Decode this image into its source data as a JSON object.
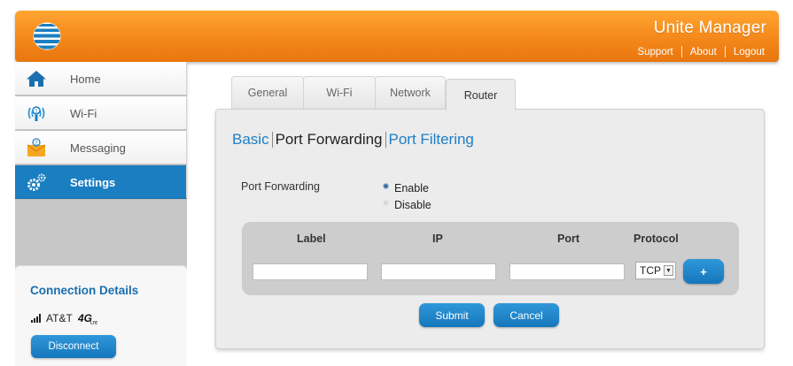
{
  "header": {
    "title": "Unite Manager",
    "links": [
      "Support",
      "About",
      "Logout"
    ],
    "logo_icon": "att-globe-icon"
  },
  "sidebar": {
    "items": [
      {
        "label": "Home",
        "icon": "home-icon",
        "active": false
      },
      {
        "label": "Wi-Fi",
        "icon": "wifi-icon",
        "active": false
      },
      {
        "label": "Messaging",
        "icon": "envelope-icon",
        "active": false
      },
      {
        "label": "Settings",
        "icon": "gear-icon",
        "active": true
      }
    ],
    "connection": {
      "title": "Connection Details",
      "carrier": "AT&T",
      "network_icon": "4g-lte-icon",
      "disconnect_label": "Disconnect"
    }
  },
  "tabs": [
    {
      "label": "General",
      "active": false
    },
    {
      "label": "Wi-Fi",
      "active": false
    },
    {
      "label": "Network",
      "active": false
    },
    {
      "label": "Router",
      "active": true
    }
  ],
  "subnav": {
    "basic": "Basic",
    "port_forwarding": "Port Forwarding",
    "port_filtering": "Port Filtering"
  },
  "port_forwarding": {
    "label": "Port Forwarding",
    "enable": "Enable",
    "disable": "Disable",
    "selected": "Enable"
  },
  "rule_table": {
    "headers": [
      "Label",
      "IP",
      "Port",
      "Protocol"
    ],
    "inputs": {
      "label": "",
      "ip": "",
      "port": ""
    },
    "protocol": "TCP",
    "add_label": "+"
  },
  "actions": {
    "submit": "Submit",
    "cancel": "Cancel"
  },
  "colors": {
    "header_orange": "#f5881a",
    "accent_blue": "#1a7ec1",
    "link_blue": "#1d7fc4",
    "panel_gray": "#ececec"
  }
}
